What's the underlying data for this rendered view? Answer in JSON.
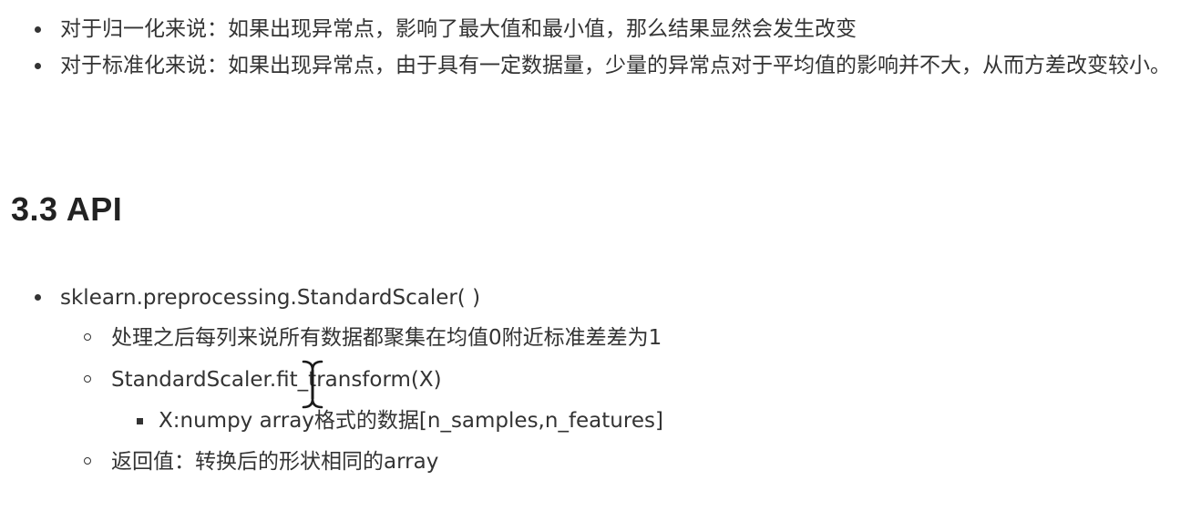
{
  "normalization_notes": [
    "对于归一化来说：如果出现异常点，影响了最大值和最小值，那么结果显然会发生改变",
    "对于标准化来说：如果出现异常点，由于具有一定数据量，少量的异常点对于平均值的影响并不大，从而方差改变较小。"
  ],
  "section": {
    "title": "3.3 API"
  },
  "api": {
    "class_name": "sklearn.preprocessing.StandardScaler( )",
    "details": [
      "处理之后每列来说所有数据都聚集在均值0附近标准差差为1",
      "StandardScaler.fit_transform(X)",
      "返回值：转换后的形状相同的array"
    ],
    "param": "X:numpy array格式的数据[n_samples,n_features]"
  },
  "icons": {
    "cursor": "text-cursor-icon",
    "text_color": "#333333"
  }
}
